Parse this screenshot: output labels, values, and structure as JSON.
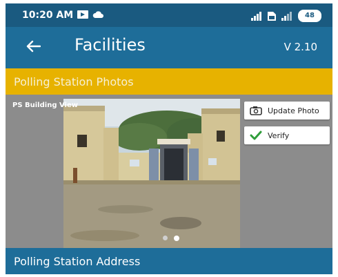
{
  "status_bar": {
    "time": "10:20 AM",
    "battery": "48"
  },
  "app_bar": {
    "title": "Facilities",
    "version": "V 2.10"
  },
  "sections": {
    "photos_title": "Polling Station Photos",
    "address_title": "Polling Station Address"
  },
  "photo_card": {
    "label": "PS Building View",
    "update_photo_label": "Update Photo",
    "verify_label": "Verify",
    "page_count": 2,
    "active_page": 2
  },
  "colors": {
    "primary": "#1e6d99",
    "status_bar": "#1a5a80",
    "accent": "#e7b200",
    "verify_check": "#2f9d3a"
  },
  "icons": {
    "back": "arrow-left-icon",
    "camera": "camera-icon",
    "check": "check-icon"
  }
}
